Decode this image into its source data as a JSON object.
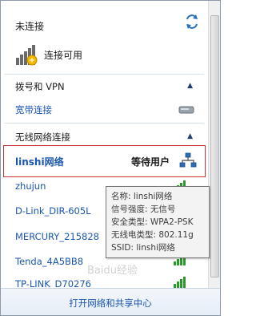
{
  "header": {
    "title": "未连接",
    "available_label": "连接可用"
  },
  "sections": {
    "dialup": {
      "title": "拨号和 VPN",
      "items": [
        {
          "label": "宽带连接"
        }
      ]
    },
    "wireless": {
      "title": "无线网络连接"
    }
  },
  "selected_network": {
    "name": "linshi网络",
    "status": "等待用户"
  },
  "networks": [
    {
      "name": "zhujun"
    },
    {
      "name": "D-Link_DIR-605L"
    },
    {
      "name": "MERCURY_215828"
    },
    {
      "name": "Tenda_4A5BB8"
    },
    {
      "name": "TP-LINK_D70276"
    }
  ],
  "tooltip": {
    "lines": [
      "名称: linshi网络",
      "信号强度: 无信号",
      "安全类型: WPA2-PSK",
      "无线电类型: 802.11g",
      "SSID: linshi网络"
    ]
  },
  "footer": {
    "link": "打开网络和共享中心"
  },
  "watermark": "Baidu经验",
  "colors": {
    "link": "#1a56b0",
    "highlight_border": "#c8303a",
    "signal": "#2a9a2a"
  }
}
